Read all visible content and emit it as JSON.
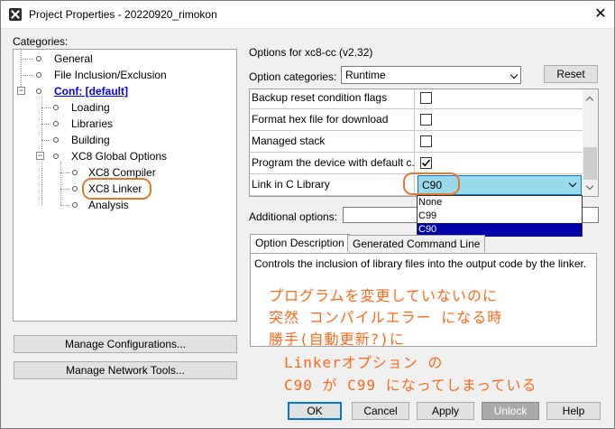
{
  "window": {
    "title": "Project Properties - 20220920_rimokon",
    "close_glyph": "✕"
  },
  "categories": {
    "label": "Categories:",
    "items": [
      {
        "label": "General"
      },
      {
        "label": "File Inclusion/Exclusion"
      },
      {
        "label": "Conf: [default]",
        "expander": "⊟"
      },
      {
        "label": "Loading"
      },
      {
        "label": "Libraries"
      },
      {
        "label": "Building"
      },
      {
        "label": "XC8 Global Options",
        "expander": "⊟"
      },
      {
        "label": "XC8 Compiler"
      },
      {
        "label": "XC8 Linker"
      },
      {
        "label": "Analysis"
      }
    ]
  },
  "options": {
    "header": "Options for xc8-cc (v2.32)",
    "category_label": "Option categories:",
    "category_value": "Runtime",
    "reset_label": "Reset",
    "rows": [
      {
        "name": "Backup reset condition flags",
        "checked": false
      },
      {
        "name": "Format hex file for download",
        "checked": false
      },
      {
        "name": "Managed stack",
        "checked": false
      },
      {
        "name": "Program the device with default c...",
        "checked": true
      },
      {
        "name": "Link in C Library",
        "value": "C90"
      }
    ],
    "dropdown_options": [
      "None",
      "C99",
      "C90"
    ],
    "additional_label": "Additional options:"
  },
  "tabs": [
    "Option Description",
    "Generated Command Line"
  ],
  "description": "Controls the inclusion of library files into the output code by the linker.",
  "annotation": {
    "lines": [
      "プログラムを変更していないのに",
      "突然 コンパイルエラー になる時",
      "勝手(自動更新?)に",
      "Linkerオプション の",
      "C90 が C99 になってしまっている"
    ],
    "color": "#ff6a1a"
  },
  "left_buttons": {
    "manage_configs": "Manage Configurations...",
    "manage_tools": "Manage Network Tools..."
  },
  "footer": {
    "ok": "OK",
    "cancel": "Cancel",
    "apply": "Apply",
    "unlock": "Unlock",
    "help": "Help"
  },
  "colors": {
    "selection": "#0000a8",
    "highlight": "#e8772e",
    "accent": "#0078d7"
  }
}
